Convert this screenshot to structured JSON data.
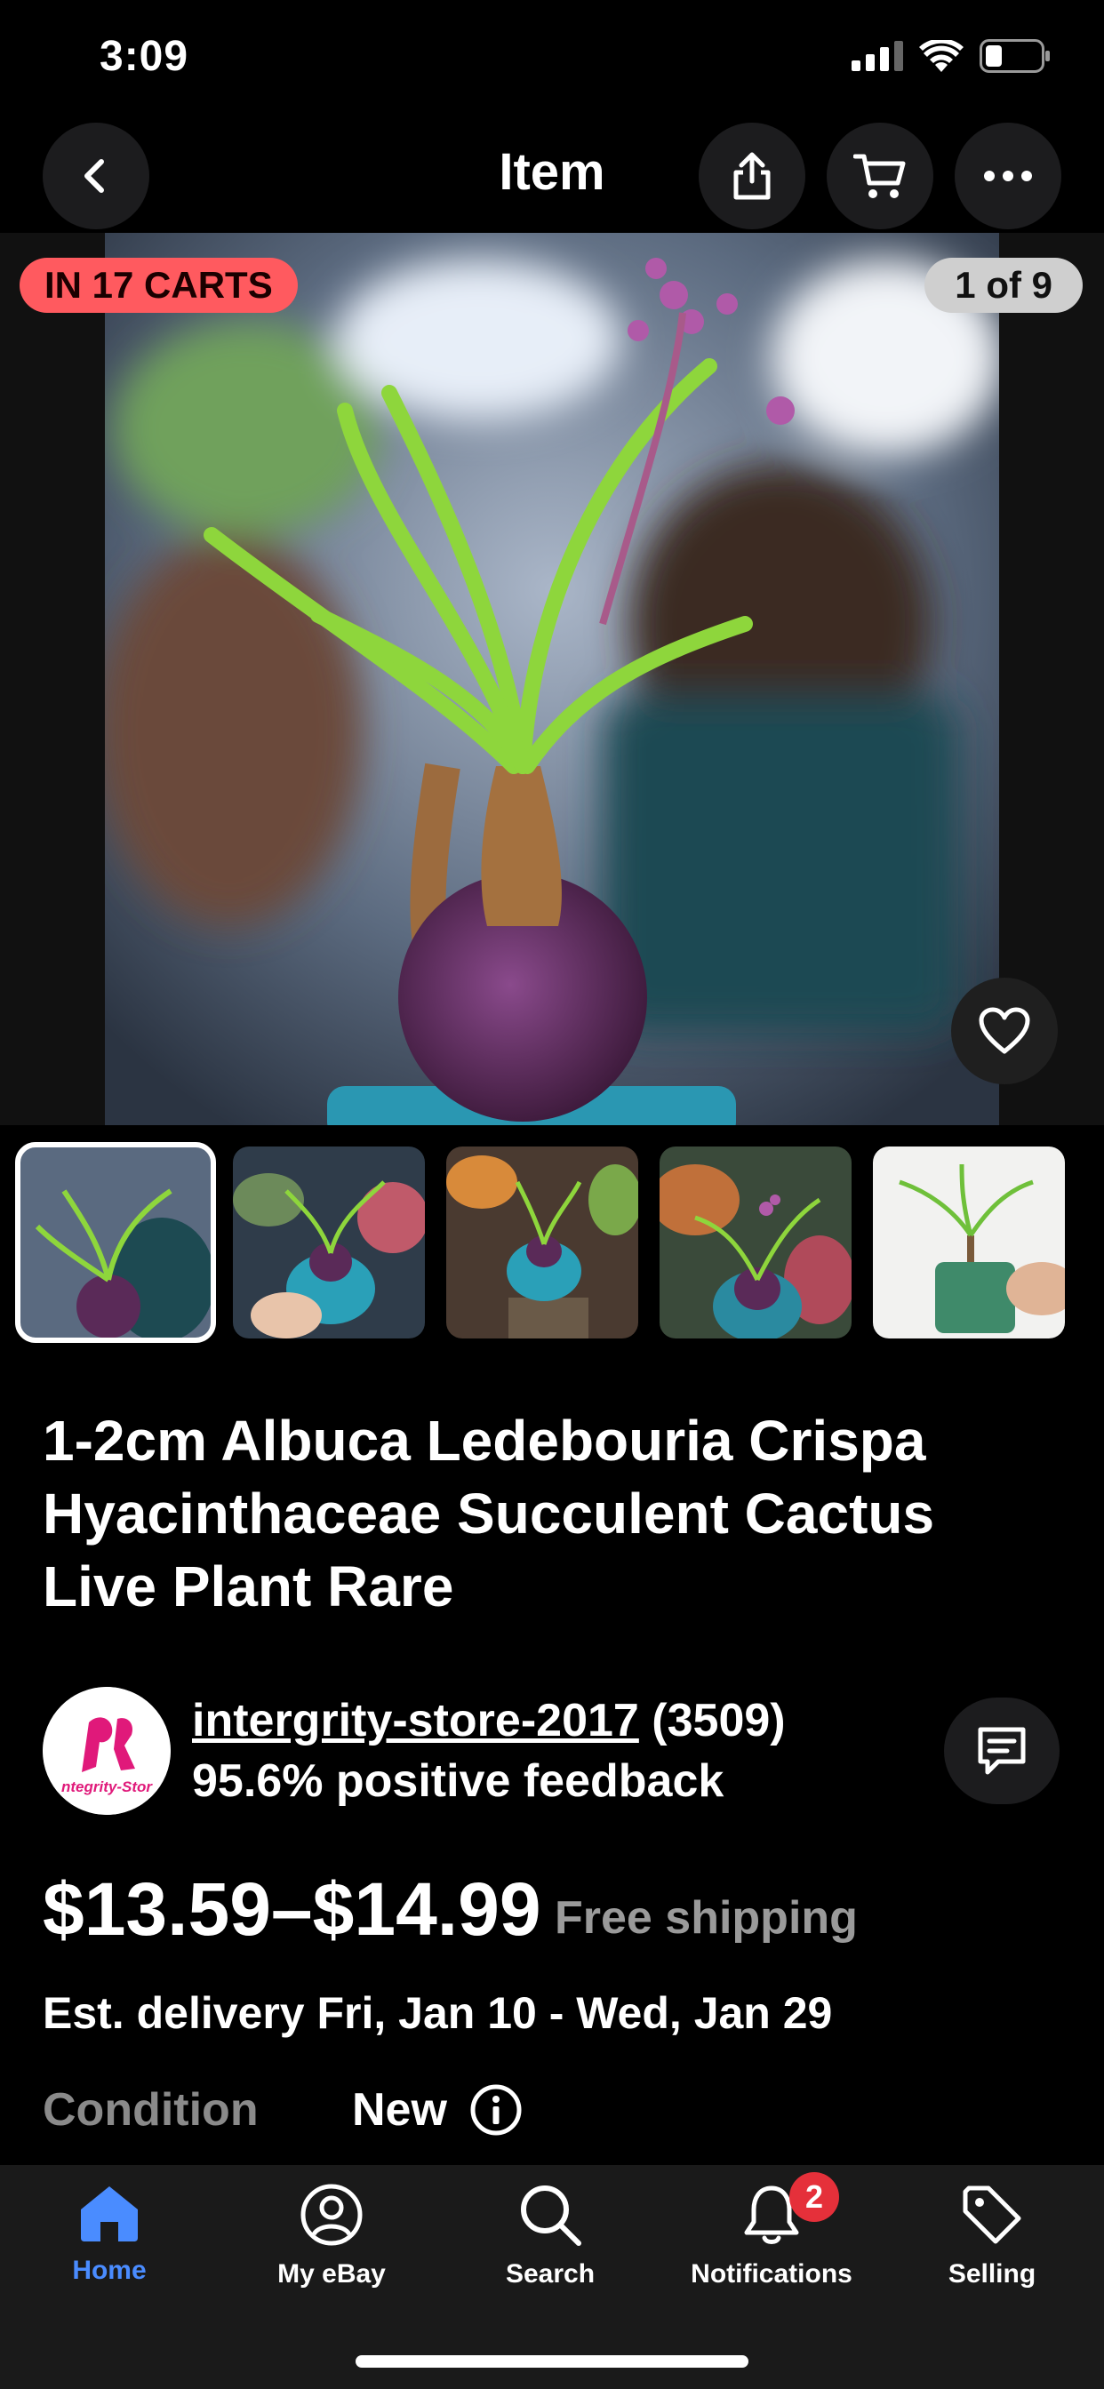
{
  "status_bar": {
    "time": "3:09"
  },
  "nav": {
    "title": "Item"
  },
  "hero": {
    "carts_badge": "IN 17 CARTS",
    "image_counter": "1 of 9"
  },
  "product": {
    "title_lines": [
      "1-2cm Albuca Ledebouria Crispa",
      "Hyacinthaceae Succulent Cactus",
      "Live Plant Rare"
    ]
  },
  "seller": {
    "logo_text": "ntegrity-Stor",
    "name": "intergrity-store-2017",
    "rating_count": "(3509)",
    "feedback": "95.6% positive feedback"
  },
  "pricing": {
    "price": "$13.59–$14.99",
    "shipping": "Free shipping",
    "delivery": "Est. delivery Fri, Jan 10 - Wed, Jan 29",
    "condition_label": "Condition",
    "condition_value": "New"
  },
  "tabbar": {
    "items": [
      {
        "label": "Home",
        "icon": "home-icon"
      },
      {
        "label": "My eBay",
        "icon": "account-icon"
      },
      {
        "label": "Search",
        "icon": "search-icon"
      },
      {
        "label": "Notifications",
        "icon": "bell-icon"
      },
      {
        "label": "Selling",
        "icon": "tag-icon"
      }
    ],
    "notification_count": "2"
  },
  "colors": {
    "accent": "#4a8cff",
    "badge": "#ff5a5f",
    "notif": "#e5303a"
  }
}
